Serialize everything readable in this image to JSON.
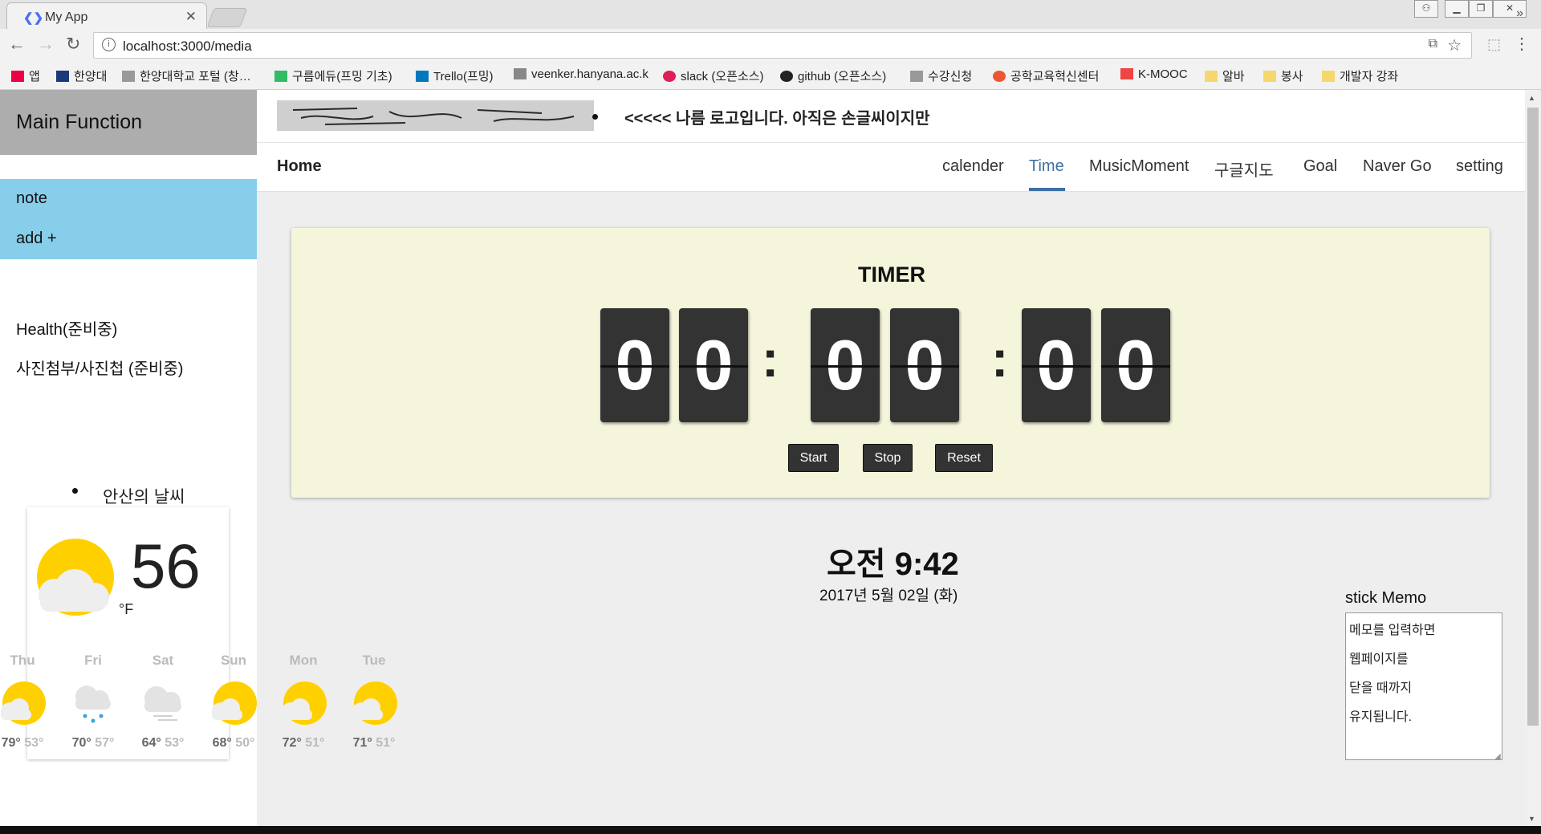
{
  "browser": {
    "tab_title": "My App",
    "tab_close": "✕",
    "url": "localhost:3000/media",
    "back": "←",
    "forward": "→",
    "reload": "↻",
    "bookmarks": [
      {
        "label": "앱",
        "icon": "apps-grid-icon"
      },
      {
        "label": "한양대",
        "icon": "hanyang-icon"
      },
      {
        "label": "한양대학교 포털 (창…",
        "icon": "page-icon"
      },
      {
        "label": "구름에듀(프밍 기초)",
        "icon": "goorm-icon"
      },
      {
        "label": "Trello(프밍)",
        "icon": "trello-icon"
      },
      {
        "label": "veenker.hanyana.ac.k",
        "icon": "document-icon"
      },
      {
        "label": "slack (오픈소스)",
        "icon": "slack-icon"
      },
      {
        "label": "github (오픈소스)",
        "icon": "github-icon"
      },
      {
        "label": "수강신청",
        "icon": "page-icon"
      },
      {
        "label": "공학교육혁신센터",
        "icon": "chrome-icon"
      },
      {
        "label": "K-MOOC",
        "icon": "kmooc-icon"
      },
      {
        "label": "알바",
        "icon": "folder-icon"
      },
      {
        "label": "봉사",
        "icon": "folder-icon"
      },
      {
        "label": "개발자 강좌",
        "icon": "folder-icon"
      }
    ],
    "bookmarks_more": "»"
  },
  "sidebar": {
    "title": "Main Function",
    "items": [
      "note",
      "add +"
    ],
    "extra_items": [
      "Health(준비중)",
      "사진첨부/사진첩 (준비중)"
    ]
  },
  "weather": {
    "title": "안산의 날씨",
    "temp": "56",
    "unit": "°F",
    "forecast": [
      {
        "day": "Thu",
        "hi": "79°",
        "lo": "53°",
        "icon": "partly-cloudy-icon"
      },
      {
        "day": "Fri",
        "hi": "70°",
        "lo": "57°",
        "icon": "rain-icon"
      },
      {
        "day": "Sat",
        "hi": "64°",
        "lo": "53°",
        "icon": "cloudy-icon"
      },
      {
        "day": "Sun",
        "hi": "68°",
        "lo": "50°",
        "icon": "partly-cloudy-icon"
      },
      {
        "day": "Mon",
        "hi": "72°",
        "lo": "51°",
        "icon": "partly-cloudy-icon"
      },
      {
        "day": "Tue",
        "hi": "71°",
        "lo": "51°",
        "icon": "partly-cloudy-icon"
      }
    ]
  },
  "header": {
    "logo_text": "<<<<< 나름 로고입니다. 아직은 손글씨이지만"
  },
  "nav": {
    "home": "Home",
    "tabs": [
      "calender",
      "Time",
      "MusicMoment",
      "구글지도",
      "Goal",
      "Naver Go",
      "setting"
    ],
    "active": "Time"
  },
  "timer": {
    "title": "TIMER",
    "digits": [
      "0",
      "0",
      "0",
      "0",
      "0",
      "0"
    ],
    "separator": ":",
    "buttons": {
      "start": "Start",
      "stop": "Stop",
      "reset": "Reset"
    }
  },
  "clock": {
    "time": "오전 9:42",
    "date": "2017년 5월 02일 (화)"
  },
  "memo": {
    "label": "stick Memo",
    "lines": [
      "메모를 입력하면",
      "웹페이지를",
      "닫을 때까지",
      "유지됩니다."
    ]
  },
  "colors": {
    "accent": "#3f6fa5",
    "sidebar_blue": "#87ceeb",
    "sidebar_header": "#adadad",
    "timer_bg": "#f5f5dc",
    "sun": "#ffd000"
  }
}
